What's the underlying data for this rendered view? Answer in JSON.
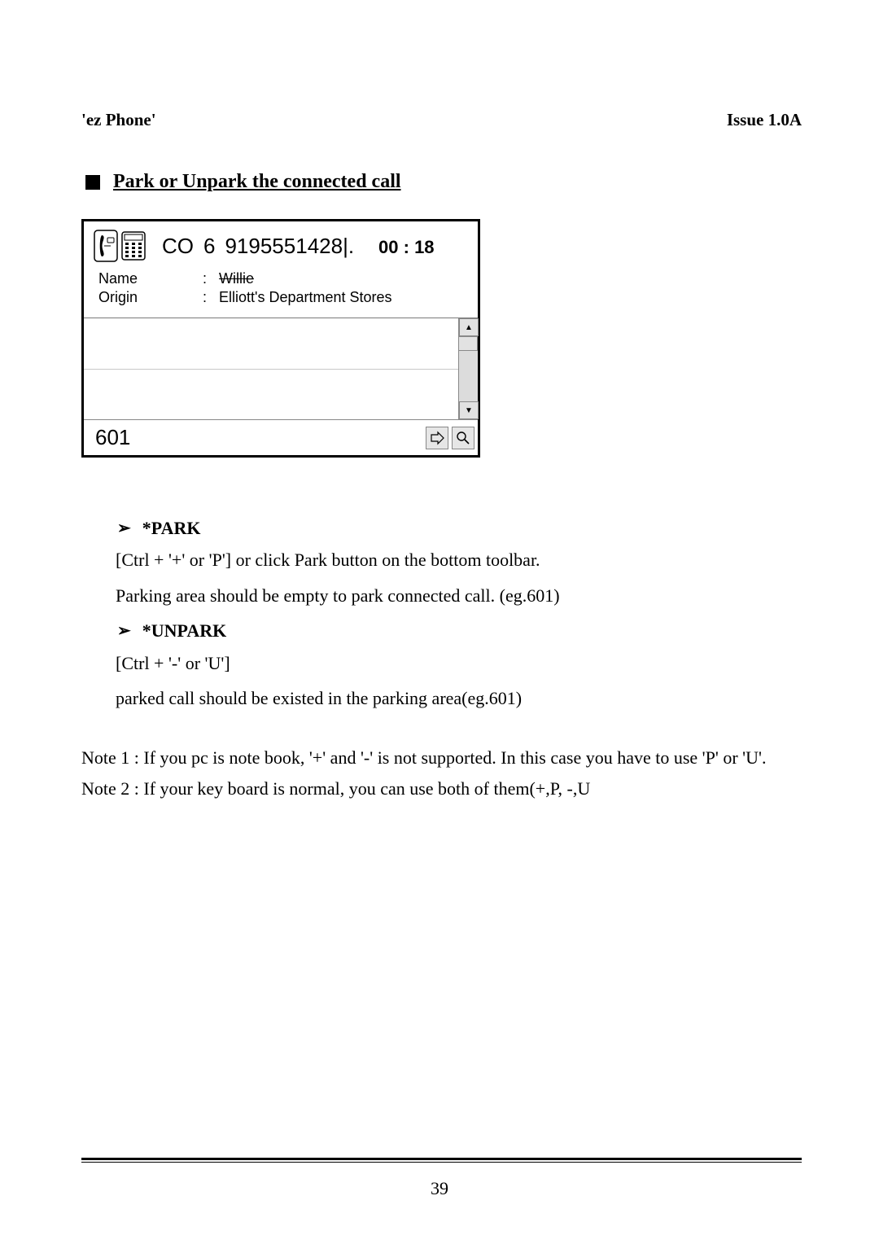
{
  "header": {
    "left": "'ez Phone'",
    "right": "Issue 1.0A"
  },
  "section": {
    "title": "Park or Unpark the connected call"
  },
  "ui": {
    "co_prefix": "CO",
    "co_channel": "6",
    "phone_number": "9195551428|.",
    "timer": "00 : 18",
    "rows": {
      "name_label": "Name",
      "name_value": "Willie",
      "origin_label": "Origin",
      "origin_value": "Elliott's Department Stores"
    },
    "extension_input": "601"
  },
  "content": {
    "park_heading": "*PARK",
    "park_line1": "[Ctrl + '+' or 'P'] or click Park button on the bottom toolbar.",
    "park_line2": "Parking area should be empty to park connected call. (eg.601)",
    "unpark_heading": "*UNPARK",
    "unpark_line1": "[Ctrl + '-' or 'U']",
    "unpark_line2": "parked call should be existed in the parking area(eg.601)",
    "note1": "Note 1 : If you pc is note book, '+' and '-' is not supported. In this case you have to use 'P' or 'U'.",
    "note2": "Note 2 : If your key board is normal, you can use both of them(+,P, -,U"
  },
  "page_number": "39"
}
